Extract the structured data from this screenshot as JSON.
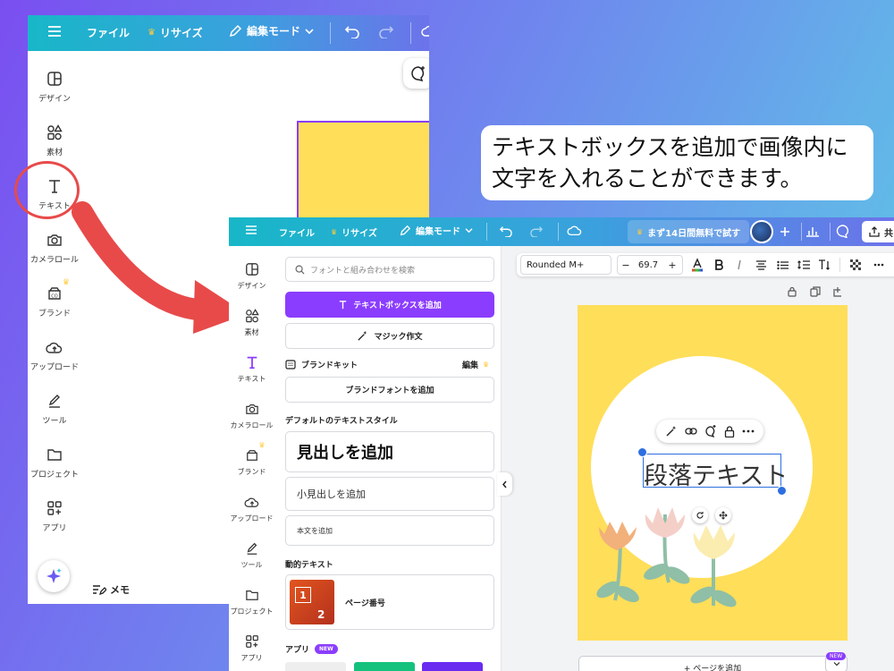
{
  "colors": {
    "accent": "#8b3dff",
    "canvas": "#ffde59",
    "highlight": "#e84a4a"
  },
  "callout": {
    "line1": "テキストボックスを追加で画像内に",
    "line2": "文字を入れることができます。"
  },
  "window1": {
    "topbar": {
      "menu_icon": "hamburger-icon",
      "file": "ファイル",
      "resize": "リサイズ",
      "edit_mode": "編集モード"
    },
    "sidebar": [
      {
        "label": "デザイン",
        "icon": "design-icon"
      },
      {
        "label": "素材",
        "icon": "elements-icon"
      },
      {
        "label": "テキスト",
        "icon": "text-icon"
      },
      {
        "label": "カメラロール",
        "icon": "camera-icon"
      },
      {
        "label": "ブランド",
        "icon": "brand-icon"
      },
      {
        "label": "アップロード",
        "icon": "upload-icon"
      },
      {
        "label": "ツール",
        "icon": "tools-icon"
      },
      {
        "label": "プロジェクト",
        "icon": "folder-icon"
      },
      {
        "label": "アプリ",
        "icon": "apps-icon"
      }
    ],
    "memo": "メモ"
  },
  "window2": {
    "topbar": {
      "file": "ファイル",
      "resize": "リサイズ",
      "edit_mode": "編集モード",
      "trial": "まず14日間無料で試す",
      "share_label": "共"
    },
    "sidebar": [
      {
        "label": "デザイン",
        "icon": "design-icon"
      },
      {
        "label": "素材",
        "icon": "elements-icon"
      },
      {
        "label": "テキスト",
        "icon": "text-icon"
      },
      {
        "label": "カメラロール",
        "icon": "camera-icon"
      },
      {
        "label": "ブランド",
        "icon": "brand-icon"
      },
      {
        "label": "アップロード",
        "icon": "upload-icon"
      },
      {
        "label": "ツール",
        "icon": "tools-icon"
      },
      {
        "label": "プロジェクト",
        "icon": "folder-icon"
      },
      {
        "label": "アプリ",
        "icon": "apps-icon"
      }
    ],
    "panel": {
      "search_placeholder": "フォントと組み合わせを検索",
      "add_textbox": "テキストボックスを追加",
      "magic_write": "マジック作文",
      "brand_kit": "ブランドキット",
      "edit": "編集",
      "add_brand_font": "ブランドフォントを追加",
      "default_styles": "デフォルトのテキストスタイル",
      "add_heading": "見出しを追加",
      "add_subheading": "小見出しを追加",
      "add_body": "本文を追加",
      "dynamic_text": "動的テキスト",
      "page_number": "ページ番号",
      "thumb_1": "1",
      "thumb_2": "2",
      "apps": "アプリ",
      "new_badge": "NEW"
    },
    "toolbar": {
      "font": "Rounded M+",
      "minus": "−",
      "size": "69.7",
      "plus": "+"
    },
    "canvas": {
      "textbox": "段落テキスト"
    },
    "add_page": "+ ページを追加",
    "new_badge": "NEW"
  }
}
